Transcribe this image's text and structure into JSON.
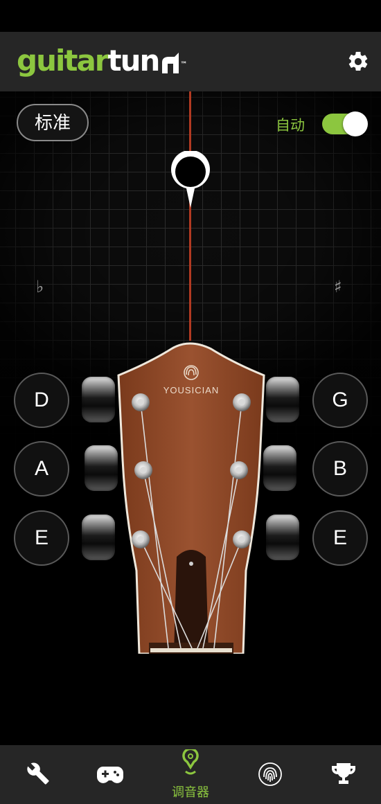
{
  "app": {
    "logo_green": "guitar",
    "logo_white": "tun",
    "logo_tm": "™"
  },
  "header": {
    "settings_icon": "gear-icon"
  },
  "tuner": {
    "tuning_label": "标准",
    "auto_label": "自动",
    "auto_enabled": true,
    "flat_symbol": "♭",
    "sharp_symbol": "♯",
    "brand": "YOUSICIAN",
    "strings_left": [
      "D",
      "A",
      "E"
    ],
    "strings_right": [
      "G",
      "B",
      "E"
    ]
  },
  "nav": {
    "items": [
      {
        "icon": "wrench-icon",
        "label": ""
      },
      {
        "icon": "gamepad-icon",
        "label": ""
      },
      {
        "icon": "tuner-pin-icon",
        "label": "调音器",
        "active": true
      },
      {
        "icon": "fingerprint-icon",
        "label": ""
      },
      {
        "icon": "trophy-icon",
        "label": ""
      }
    ]
  },
  "colors": {
    "accent": "#8cc63f",
    "bar": "#262626",
    "needle": "#b23a22"
  }
}
